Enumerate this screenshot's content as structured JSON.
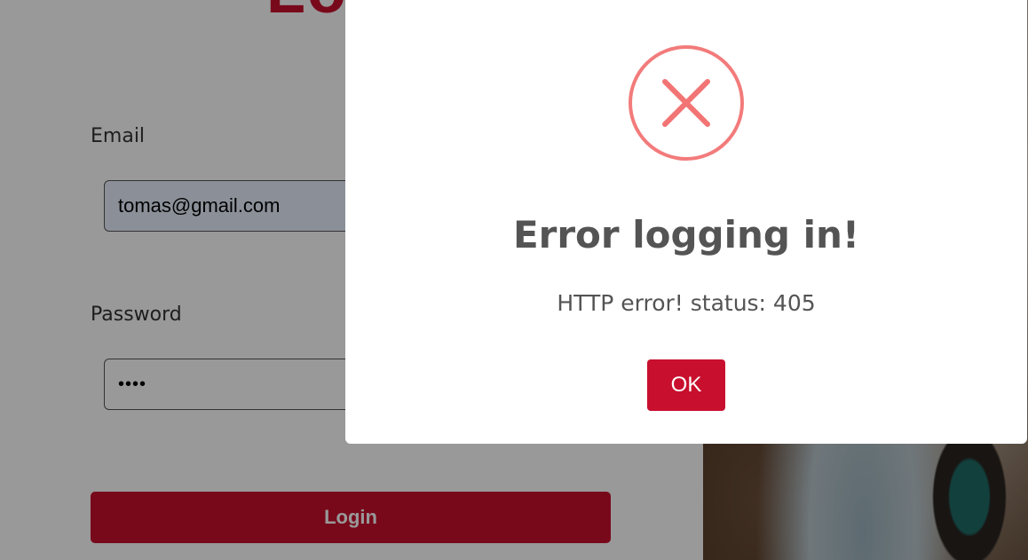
{
  "login": {
    "title": "Log",
    "email_label": "Email",
    "email_value": "tomas@gmail.com",
    "password_label": "Password",
    "password_value": "••••",
    "login_button": "Login"
  },
  "modal": {
    "icon": "error-x-icon",
    "title": "Error logging in!",
    "message": "HTTP error! status: 405",
    "ok_button": "OK"
  },
  "colors": {
    "brand_red": "#c8102e",
    "error_icon": "#f27474",
    "text_gray": "#545454"
  }
}
